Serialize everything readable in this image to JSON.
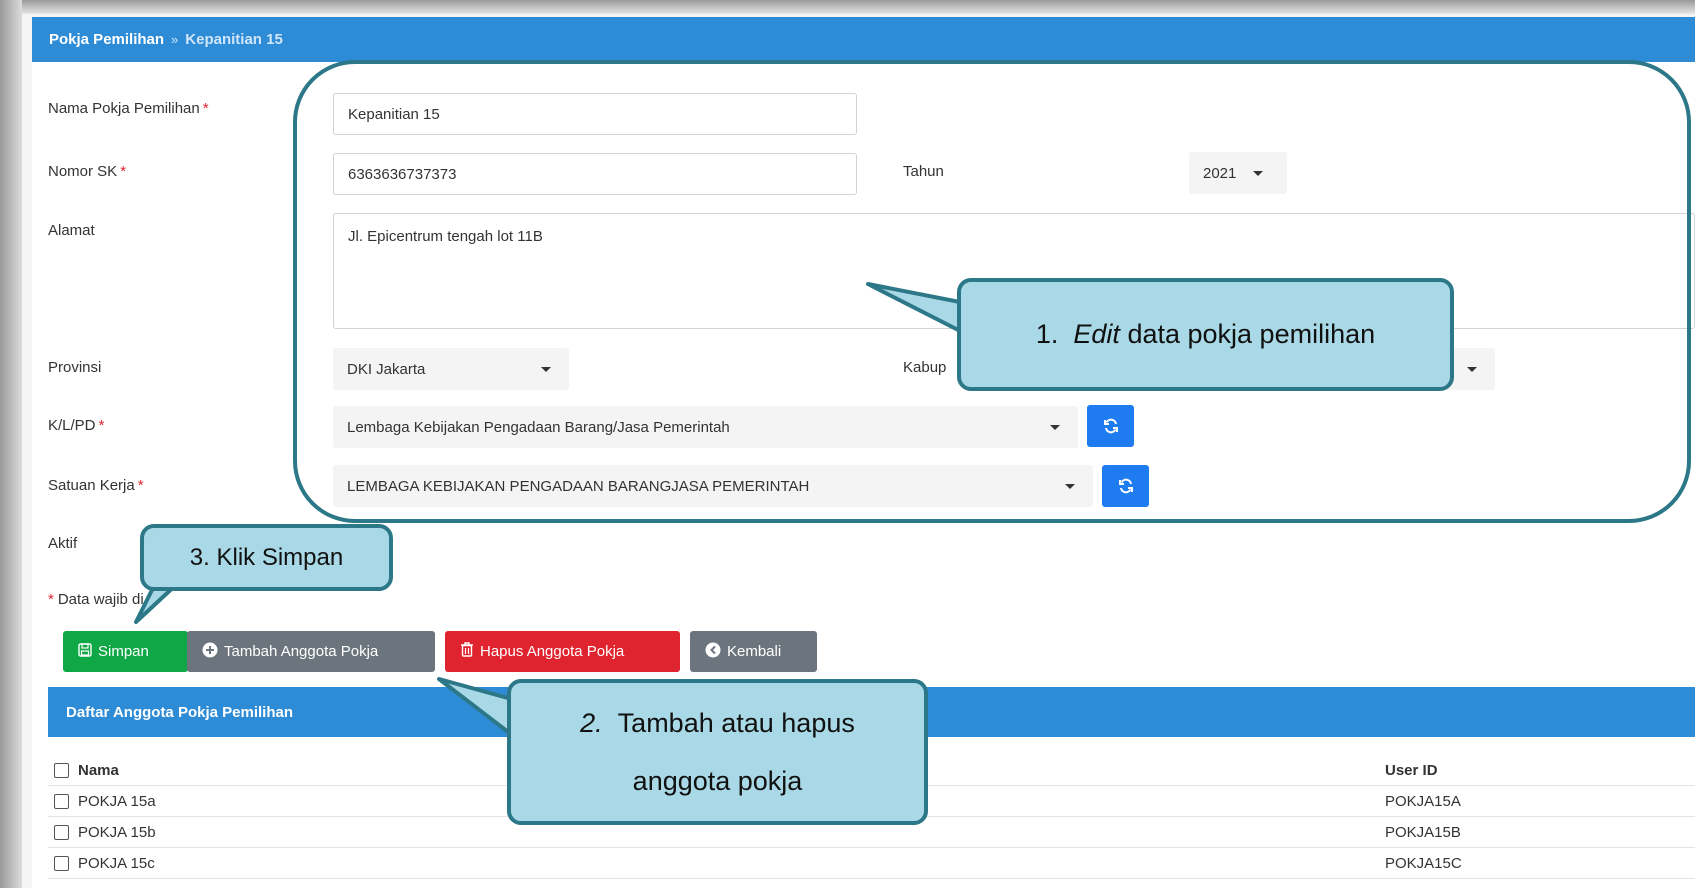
{
  "breadcrumb": {
    "parent": "Pokja Pemilihan",
    "separator": "»",
    "current": "Kepanitian 15"
  },
  "form": {
    "nama_label": "Nama Pokja Pemilihan",
    "nama_value": "Kepanitian 15",
    "nomor_sk_label": "Nomor SK",
    "nomor_sk_value": "6363636737373",
    "tahun_label": "Tahun",
    "tahun_value": "2021",
    "alamat_label": "Alamat",
    "alamat_value": "Jl. Epicentrum tengah lot 11B",
    "provinsi_label": "Provinsi",
    "provinsi_value": "DKI Jakarta",
    "kabupaten_label": "Kabup",
    "klpd_label": "K/L/PD",
    "klpd_value": "Lembaga Kebijakan Pengadaan Barang/Jasa Pemerintah",
    "satker_label": "Satuan Kerja",
    "satker_value": "LEMBAGA KEBIJAKAN PENGADAAN BARANGJASA PEMERINTAH",
    "aktif_label": "Aktif",
    "required_marker": "*",
    "required_note": "Data wajib di"
  },
  "buttons": {
    "simpan": "Simpan",
    "tambah": "Tambah Anggota Pokja",
    "hapus": "Hapus Anggota Pokja",
    "kembali": "Kembali"
  },
  "list": {
    "title": "Daftar Anggota Pokja Pemilihan",
    "col_nama": "Nama",
    "col_user": "User ID",
    "rows": [
      {
        "nama": "POKJA 15a",
        "user": "POKJA15A"
      },
      {
        "nama": "POKJA 15b",
        "user": "POKJA15B"
      },
      {
        "nama": "POKJA 15c",
        "user": "POKJA15C"
      }
    ]
  },
  "callouts": {
    "c1_num": "1.",
    "c1_em": "Edit",
    "c1_rest": "data pokja pemilihan",
    "c2_num": "2.",
    "c2_line1": "Tambah atau hapus",
    "c2_line2": "anggota pokja",
    "c3": "3. Klik Simpan"
  },
  "colors": {
    "header_blue": "#2e8bd6",
    "simpan_green": "#10a847",
    "tambah_gray": "#6c757d",
    "hapus_red": "#e0242f",
    "refresh_blue": "#1f7cf0",
    "callout_fill": "#a9d9e6",
    "callout_border": "#2d7888"
  },
  "icons": {
    "simpan": "floppy-disk-icon",
    "tambah": "plus-circle-icon",
    "hapus": "trash-icon",
    "kembali": "arrow-left-circle-icon",
    "refresh": "refresh-icon",
    "dropdown": "caret-down-icon",
    "checkbox": "checkbox-icon"
  }
}
